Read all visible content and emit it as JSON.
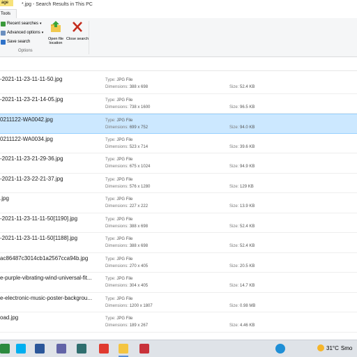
{
  "titlebar": {
    "context_tab": "age",
    "title": "*.jpg - Search Results in This PC"
  },
  "ribbon": {
    "tab_tools": "Tools",
    "recent_searches": "Recent searches",
    "advanced_options": "Advanced options",
    "save_search": "Save search",
    "open_file_location": "Open file location",
    "close_search": "Close search",
    "group_options": "Options"
  },
  "labels": {
    "type": "Type:",
    "dimensions": "Dimensions:",
    "size": "Size:"
  },
  "files": [
    {
      "name": "-2021-11-23-11-11-50.jpg",
      "type": "JPG File",
      "dimensions": "388 x 698",
      "size": "52.4 KB"
    },
    {
      "name": "-2021-11-23-21-14-05.jpg",
      "type": "JPG File",
      "dimensions": "738 x 1600",
      "size": "96.5 KB"
    },
    {
      "name": "0211122-WA0042.jpg",
      "type": "JPG File",
      "dimensions": "699 x 752",
      "size": "94.0 KB"
    },
    {
      "name": "0211122-WA0034.jpg",
      "type": "JPG File",
      "dimensions": "523 x 714",
      "size": "39.6 KB"
    },
    {
      "name": "-2021-11-23-21-29-36.jpg",
      "type": "JPG File",
      "dimensions": "675 x 1024",
      "size": "94.9 KB"
    },
    {
      "name": "-2021-11-23-22-21-37.jpg",
      "type": "JPG File",
      "dimensions": "576 x 1280",
      "size": "129 KB"
    },
    {
      "name": ".jpg",
      "type": "JPG File",
      "dimensions": "227 x 222",
      "size": "13.9 KB"
    },
    {
      "name": "-2021-11-23-11-11-50[1190].jpg",
      "type": "JPG File",
      "dimensions": "388 x 698",
      "size": "52.4 KB"
    },
    {
      "name": "-2021-11-23-11-11-50[1188].jpg",
      "type": "JPG File",
      "dimensions": "388 x 698",
      "size": "52.4 KB"
    },
    {
      "name": "ac86487c3014cb1a2567cca94b.jpg",
      "type": "JPG File",
      "dimensions": "270 x 405",
      "size": "20.5 KB"
    },
    {
      "name": "e-purple-vibrating-wind-universal-fit...",
      "type": "JPG File",
      "dimensions": "304 x 405",
      "size": "14.7 KB"
    },
    {
      "name": "e-electronic-music-poster-backgrou...",
      "type": "JPG File",
      "dimensions": "1200 x 1807",
      "size": "0.98 MB"
    },
    {
      "name": "oad.jpg",
      "type": "JPG File",
      "dimensions": "189 x 267",
      "size": "4.46 KB"
    }
  ],
  "selected_index": 2,
  "taskbar": {
    "apps": [
      {
        "icon": "windows-store-icon",
        "color": "#2b8a3e"
      },
      {
        "icon": "skype-icon",
        "color": "#00aff0"
      },
      {
        "icon": "word-icon",
        "color": "#2b579a"
      },
      {
        "icon": "teams-icon",
        "color": "#6264a7"
      },
      {
        "icon": "photos-icon",
        "color": "#2f6f6f"
      },
      {
        "icon": "acrobat-icon",
        "color": "#e03a2f"
      },
      {
        "icon": "file-explorer-icon",
        "color": "#f4c542"
      },
      {
        "icon": "security-app-icon",
        "color": "#c8323a"
      }
    ],
    "help_icon": "help-icon",
    "temperature": "31°C",
    "weather_text": "Smo"
  }
}
